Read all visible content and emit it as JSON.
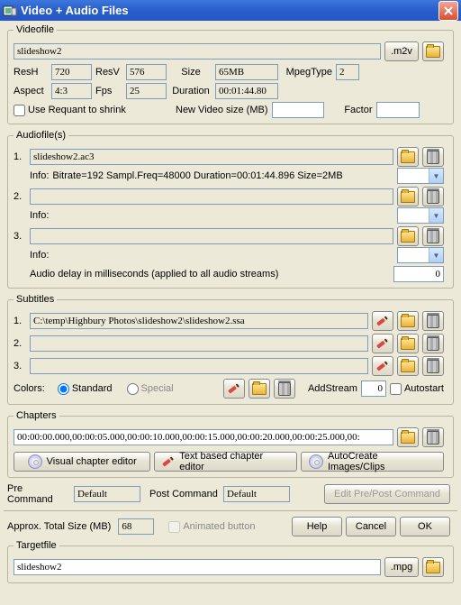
{
  "window": {
    "title": "Video + Audio Files"
  },
  "videofile": {
    "legend": "Videofile",
    "path": "slideshow2",
    "ext": ".m2v",
    "resH_label": "ResH",
    "resH": "720",
    "resV_label": "ResV",
    "resV": "576",
    "size_label": "Size",
    "size": "65MB",
    "mpegType_label": "MpegType",
    "mpegType": "2",
    "aspect_label": "Aspect",
    "aspect": "4:3",
    "fps_label": "Fps",
    "fps": "25",
    "duration_label": "Duration",
    "duration": "00:01:44.80",
    "requant_label": "Use Requant to shrink",
    "newsize_label": "New Video size (MB)",
    "newsize": "",
    "factor_label": "Factor",
    "factor": ""
  },
  "audiofiles": {
    "legend": "Audiofile(s)",
    "items": [
      {
        "num": "1.",
        "path": "slideshow2.ac3",
        "info_label": "Info:",
        "info": "Bitrate=192  Sampl.Freq=48000  Duration=00:01:44.896  Size=2MB"
      },
      {
        "num": "2.",
        "path": "",
        "info_label": "Info:",
        "info": ""
      },
      {
        "num": "3.",
        "path": "",
        "info_label": "Info:",
        "info": ""
      }
    ],
    "delay_label": "Audio delay in milliseconds (applied to all audio streams)",
    "delay": "0"
  },
  "subtitles": {
    "legend": "Subtitles",
    "items": [
      {
        "num": "1.",
        "path": "C:\\temp\\Highbury Photos\\slideshow2\\slideshow2.ssa"
      },
      {
        "num": "2.",
        "path": ""
      },
      {
        "num": "3.",
        "path": ""
      }
    ],
    "colors_label": "Colors:",
    "standard_label": "Standard",
    "special_label": "Special",
    "addstream_label": "AddStream",
    "addstream_value": "0",
    "autostart_label": "Autostart"
  },
  "chapters": {
    "legend": "Chapters",
    "value": "00:00:00.000,00:00:05.000,00:00:10.000,00:00:15.000,00:00:20.000,00:00:25.000,00:",
    "visual_btn": "Visual chapter editor",
    "text_btn": "Text based chapter editor",
    "auto_btn": "AutoCreate Images/Clips"
  },
  "commands": {
    "pre_label": "Pre Command",
    "pre_value": "Default",
    "post_label": "Post Command",
    "post_value": "Default",
    "edit_btn": "Edit Pre/Post Command"
  },
  "bottom": {
    "total_label": "Approx. Total Size (MB)",
    "total_value": "68",
    "anim_label": "Animated button",
    "help_btn": "Help",
    "cancel_btn": "Cancel",
    "ok_btn": "OK"
  },
  "targetfile": {
    "legend": "Targetfile",
    "path": "slideshow2",
    "ext": ".mpg"
  }
}
